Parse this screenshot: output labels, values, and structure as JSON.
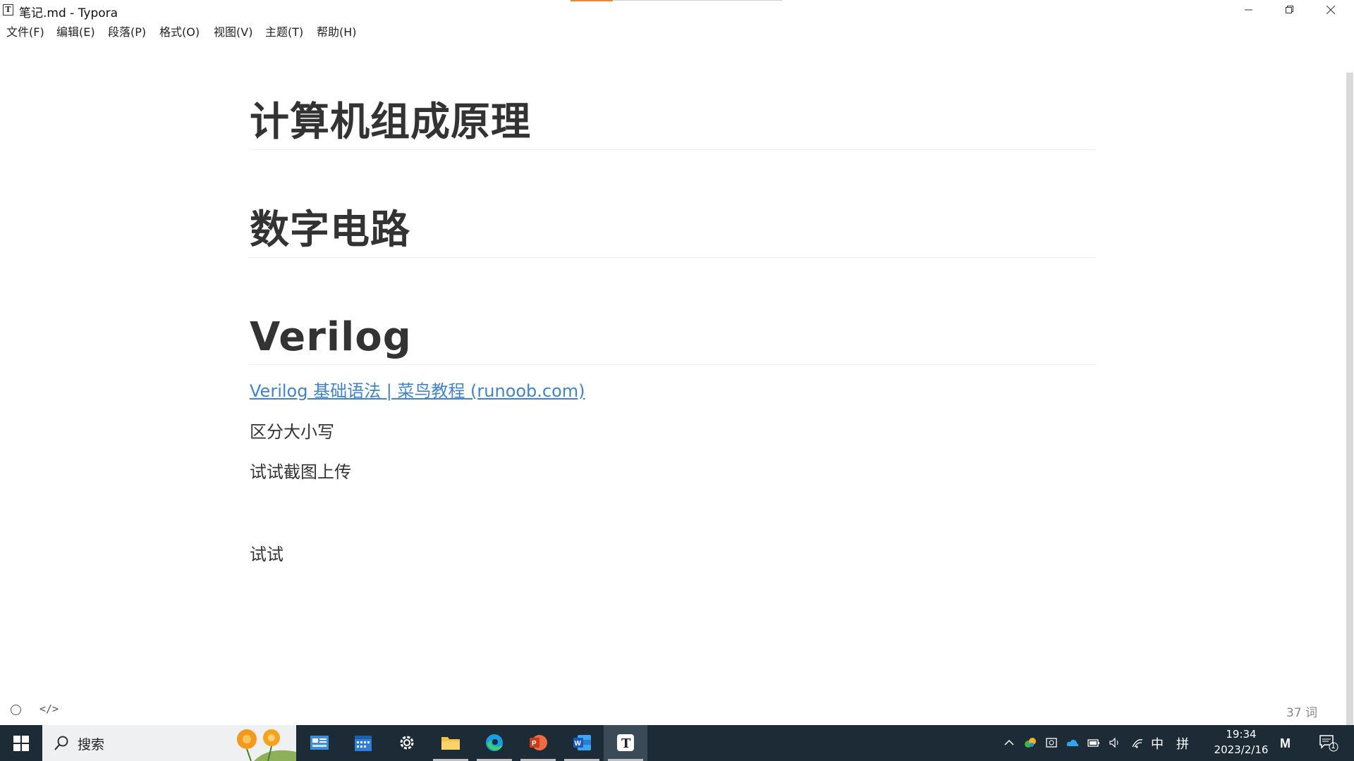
{
  "window": {
    "title": "笔记.md - Typora",
    "app_icon_letter": "T"
  },
  "menu": [
    {
      "label": "文件(F)"
    },
    {
      "label": "编辑(E)"
    },
    {
      "label": "段落(P)"
    },
    {
      "label": "格式(O)"
    },
    {
      "label": "视图(V)"
    },
    {
      "label": "主题(T)"
    },
    {
      "label": "帮助(H)"
    }
  ],
  "document": {
    "headings": [
      "计算机组成原理",
      "数字电路",
      "Verilog"
    ],
    "link_text": "Verilog 基础语法 | 菜鸟教程 (runoob.com)",
    "paragraphs": [
      "区分大小写",
      "试试截图上传",
      "试试"
    ]
  },
  "footer": {
    "code_toggle": "</>",
    "word_count": "37 词"
  },
  "taskbar": {
    "search_placeholder": "搜索",
    "apps": [
      {
        "name": "control-panel",
        "color": "#3b8fd9"
      },
      {
        "name": "calendar",
        "color": "#2f7fd8"
      },
      {
        "name": "settings",
        "color": "#ffffff"
      },
      {
        "name": "file-explorer",
        "color": "#f5c242"
      },
      {
        "name": "edge",
        "color": "#2fb8e6"
      },
      {
        "name": "powerpoint",
        "color": "#d35230"
      },
      {
        "name": "word",
        "color": "#2b5797"
      },
      {
        "name": "typora",
        "color": "#ffffff"
      }
    ],
    "ime_mode": "中",
    "ime_layout": "拼",
    "time": "19:34",
    "date": "2023/2/16",
    "notification_count": "1"
  }
}
